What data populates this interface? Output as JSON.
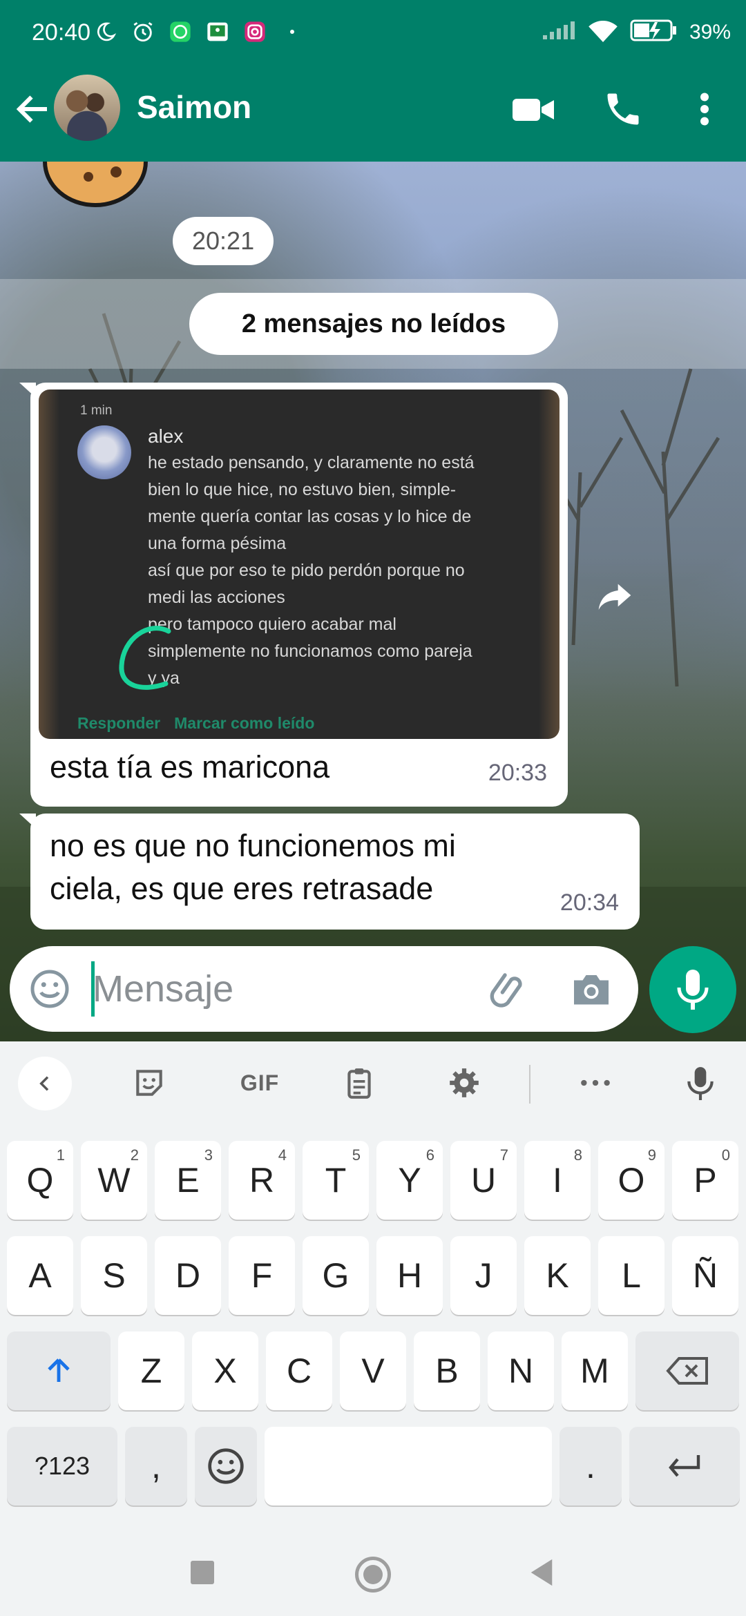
{
  "status_bar": {
    "time": "20:40",
    "battery": "39%",
    "icons": [
      "moon-icon",
      "alarm-icon",
      "whatsapp-icon",
      "classroom-icon",
      "instagram-icon",
      "dot-icon",
      "signal-icon",
      "wifi-icon",
      "battery-charging-icon"
    ]
  },
  "header": {
    "contact_name": "Saimon",
    "icons": [
      "back-arrow-icon",
      "video-camera-icon",
      "phone-icon",
      "more-vert-icon"
    ]
  },
  "chat": {
    "time_chip": "20:21",
    "unread_label": "2 mensajes no leídos",
    "messages": [
      {
        "screenshot": {
          "time_ago": "1 min",
          "sender": "alex",
          "lines": [
            "he estado pensando, y claramente no está",
            "bien lo que hice, no estuvo bien, simple-",
            "mente quería contar las cosas y lo hice de",
            "una forma pésima",
            "así que por eso te pido perdón porque no",
            "medi las acciones",
            "pero tampoco quiero acabar mal",
            "simplemente no funcionamos como pareja",
            "y ya"
          ],
          "actions": [
            "Responder",
            "Marcar como leído"
          ]
        },
        "text": "esta tía es maricona",
        "time": "20:33"
      },
      {
        "text_lines": [
          "no es que no funcionemos mi",
          "ciela, es que eres retrasade"
        ],
        "time": "20:34"
      }
    ]
  },
  "compose": {
    "placeholder": "Mensaje",
    "value": ""
  },
  "keyboard": {
    "toolbar": {
      "gif": "GIF",
      "icons": [
        "chevron-left-icon",
        "sticker-icon",
        "clipboard-icon",
        "settings-gear-icon",
        "more-horiz-icon",
        "mic-icon"
      ]
    },
    "row1": [
      {
        "k": "Q",
        "h": "1"
      },
      {
        "k": "W",
        "h": "2"
      },
      {
        "k": "E",
        "h": "3"
      },
      {
        "k": "R",
        "h": "4"
      },
      {
        "k": "T",
        "h": "5"
      },
      {
        "k": "Y",
        "h": "6"
      },
      {
        "k": "U",
        "h": "7"
      },
      {
        "k": "I",
        "h": "8"
      },
      {
        "k": "O",
        "h": "9"
      },
      {
        "k": "P",
        "h": "0"
      }
    ],
    "row2": [
      "A",
      "S",
      "D",
      "F",
      "G",
      "H",
      "J",
      "K",
      "L",
      "Ñ"
    ],
    "row3": [
      "Z",
      "X",
      "C",
      "V",
      "B",
      "N",
      "M"
    ],
    "symbols_key": "?123",
    "comma_key": ",",
    "period_key": "."
  },
  "colors": {
    "header_green": "#008069",
    "accent_green": "#00a884"
  }
}
